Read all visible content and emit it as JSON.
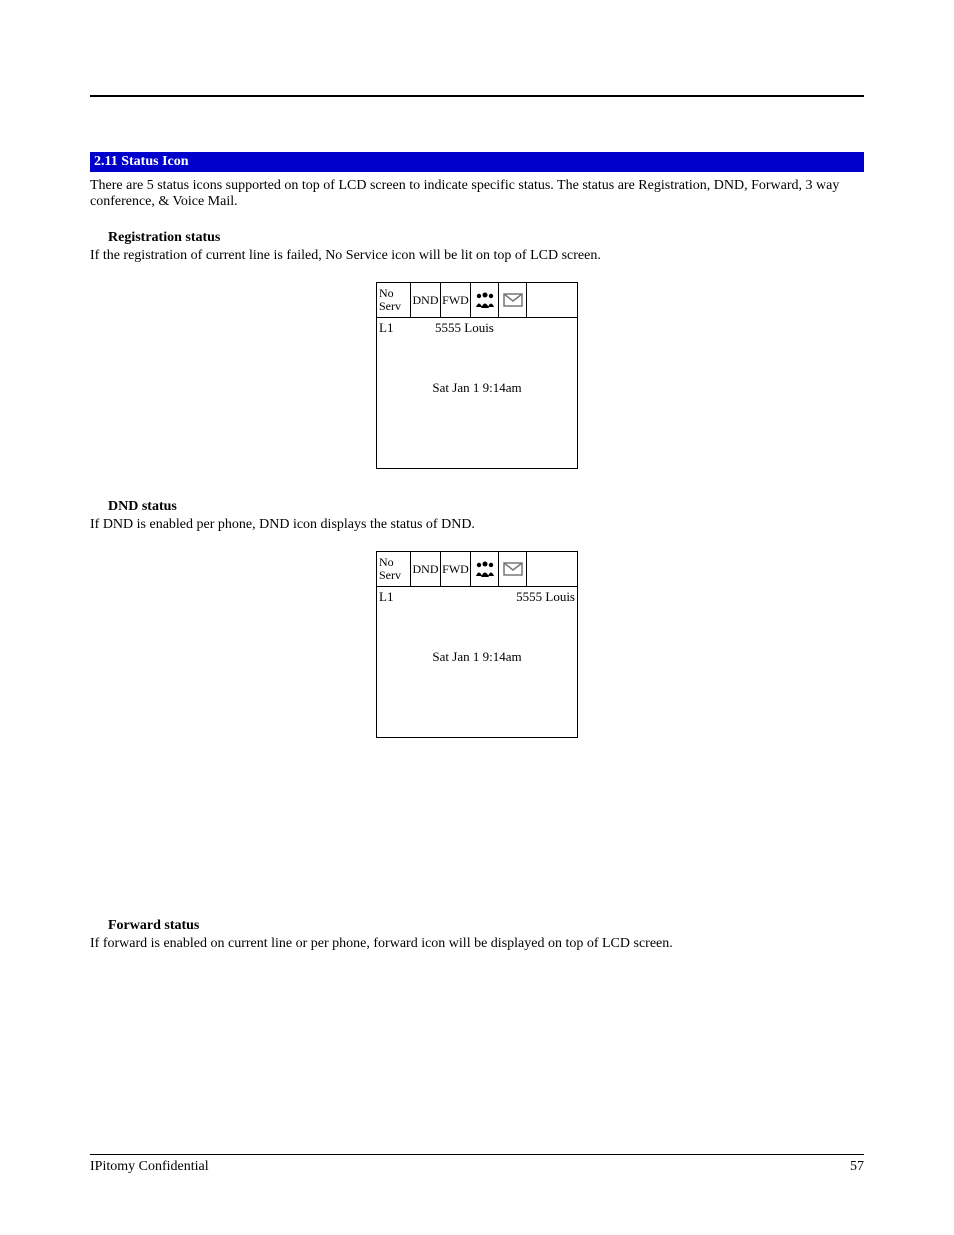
{
  "section": {
    "number": "2.11",
    "title": "Status Icon",
    "full_heading": "2.11 Status Icon"
  },
  "intro": "There are 5 status icons supported on top of LCD screen to indicate specific status. The status are Registration, DND, Forward, 3 way conference, & Voice Mail.",
  "registration": {
    "heading": "Registration status",
    "desc": "If the registration of current line is failed, No Service icon will be lit on top of LCD screen."
  },
  "dnd": {
    "heading": "DND status",
    "desc": "If DND is enabled per phone, DND icon displays the status of DND."
  },
  "forward": {
    "heading": "Forward status",
    "desc": "If forward is enabled on current line or per phone, forward icon will be displayed on top of LCD screen."
  },
  "lcd": {
    "noserv": "No Serv",
    "dnd": "DND",
    "fwd": "FWD",
    "line": "L1",
    "ext_name": "5555  Louis",
    "datetime": "Sat Jan 1 9:14am"
  },
  "footer": {
    "left": "IPitomy Confidential",
    "page": "57"
  }
}
